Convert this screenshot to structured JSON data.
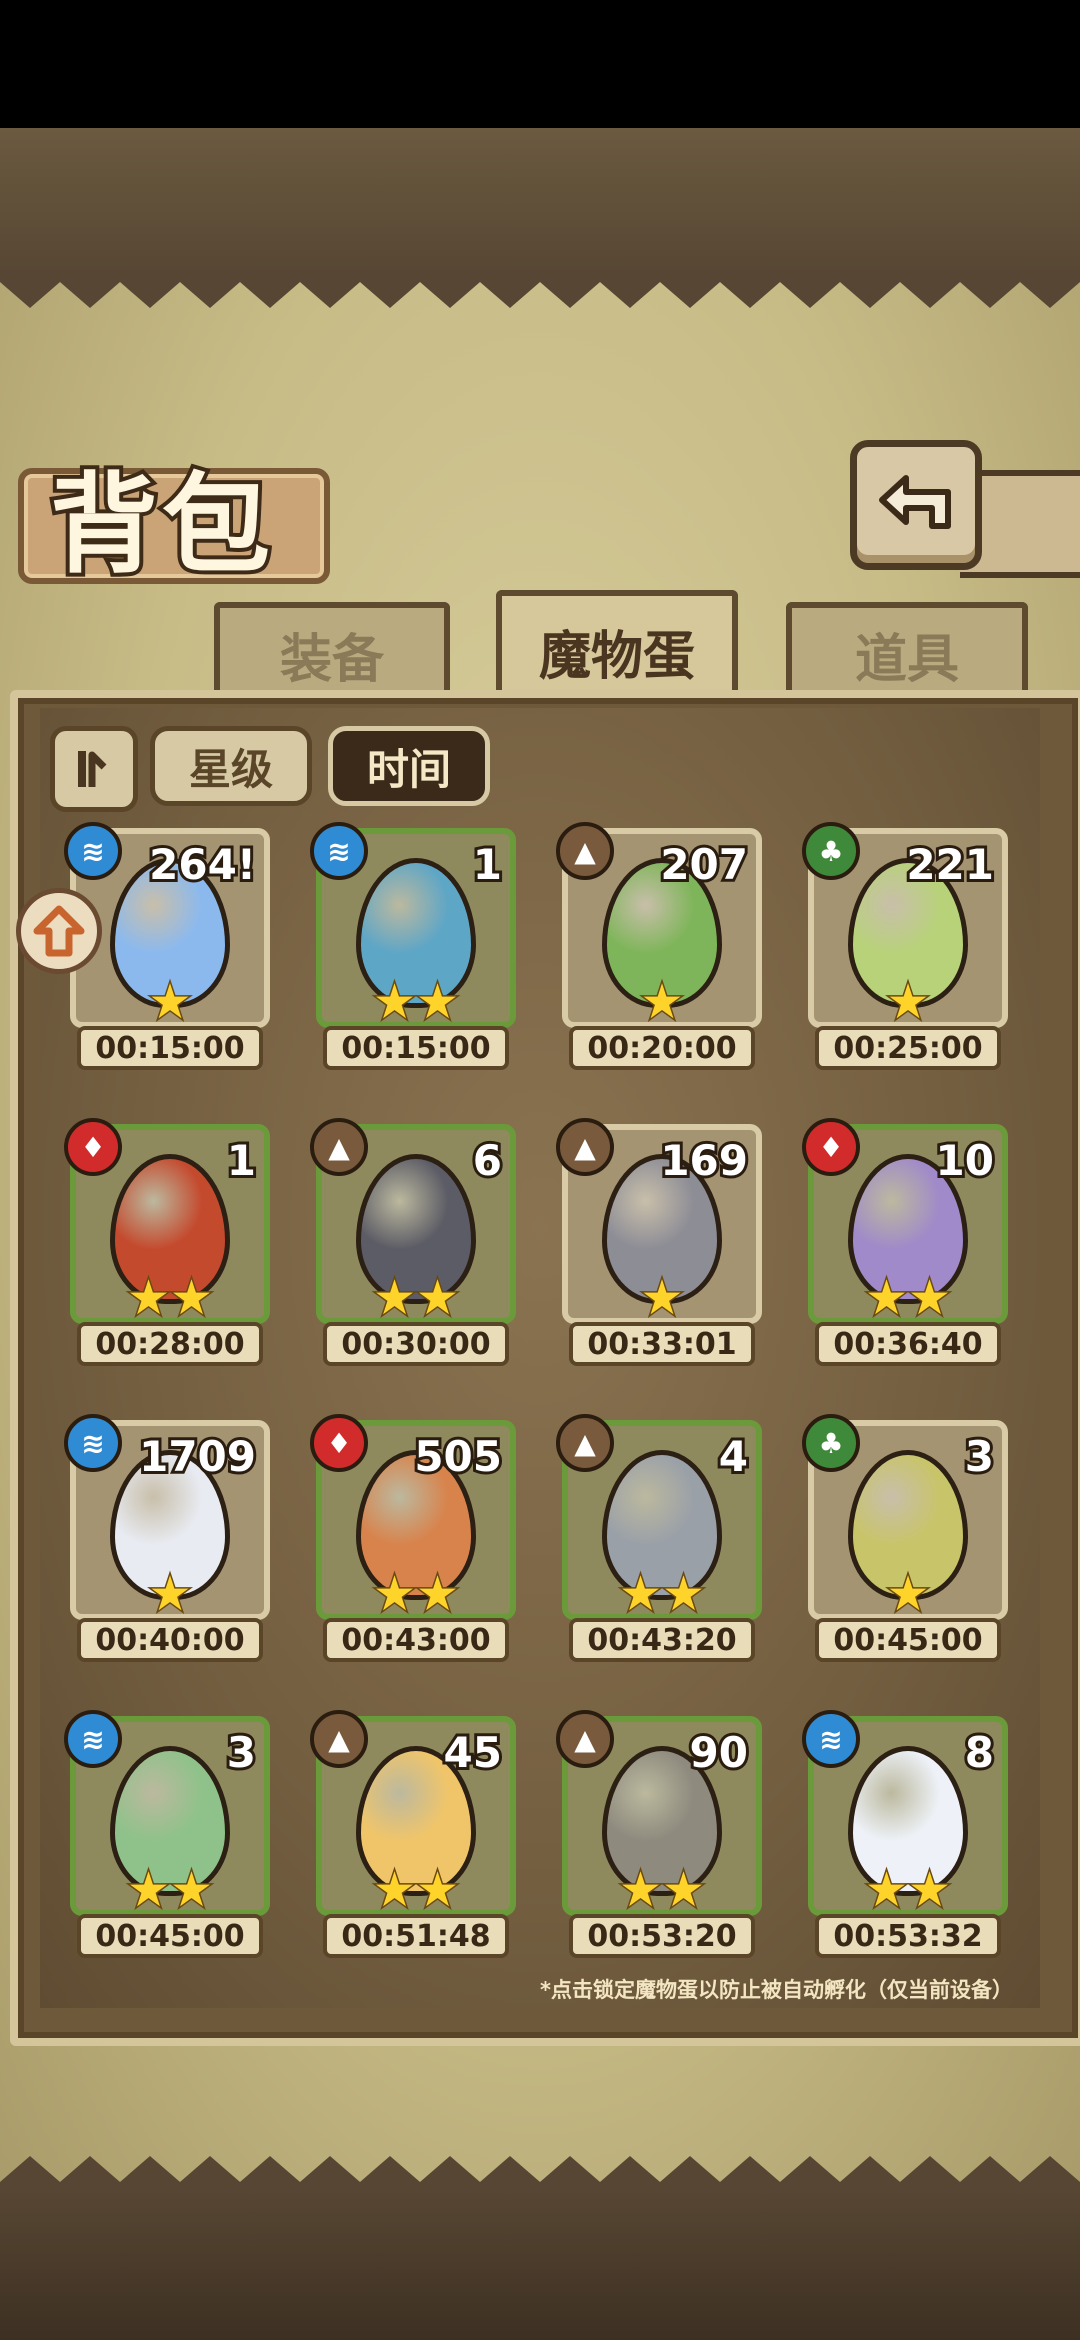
{
  "header": {
    "title": "背包",
    "back_icon": "back-arrow-icon"
  },
  "tabs": [
    {
      "label": "装备",
      "active": false
    },
    {
      "label": "魔物蛋",
      "active": true
    },
    {
      "label": "道具",
      "active": false
    }
  ],
  "sort": {
    "toggle_icon": "sort-order-icon",
    "star_label": "星级",
    "time_label": "时间",
    "active": "时间"
  },
  "eggs": [
    {
      "count": "264!",
      "element": "water",
      "stars": 1,
      "time": "00:15:00",
      "color": "#8bb9ee"
    },
    {
      "count": "1",
      "element": "water",
      "stars": 2,
      "time": "00:15:00",
      "color": "#5ea6c6"
    },
    {
      "count": "207",
      "element": "earth",
      "stars": 1,
      "time": "00:20:00",
      "color": "#7fb55a"
    },
    {
      "count": "221",
      "element": "grass",
      "stars": 1,
      "time": "00:25:00",
      "color": "#b8d27a"
    },
    {
      "count": "1",
      "element": "fire",
      "stars": 2,
      "time": "00:28:00",
      "color": "#c44a2e"
    },
    {
      "count": "6",
      "element": "earth",
      "stars": 2,
      "time": "00:30:00",
      "color": "#5c5c66"
    },
    {
      "count": "169",
      "element": "earth",
      "stars": 1,
      "time": "00:33:01",
      "color": "#8d8d96"
    },
    {
      "count": "10",
      "element": "fire",
      "stars": 2,
      "time": "00:36:40",
      "color": "#a08ac9"
    },
    {
      "count": "1709",
      "element": "water",
      "stars": 1,
      "time": "00:40:00",
      "color": "#e8ebf2"
    },
    {
      "count": "505",
      "element": "fire",
      "stars": 2,
      "time": "00:43:00",
      "color": "#d8834c"
    },
    {
      "count": "4",
      "element": "earth",
      "stars": 2,
      "time": "00:43:20",
      "color": "#9aa0a8"
    },
    {
      "count": "3",
      "element": "grass",
      "stars": 1,
      "time": "00:45:00",
      "color": "#c8c46a"
    },
    {
      "count": "3",
      "element": "water",
      "stars": 2,
      "time": "00:45:00",
      "color": "#8fc28a"
    },
    {
      "count": "45",
      "element": "earth",
      "stars": 2,
      "time": "00:51:48",
      "color": "#f0c56a"
    },
    {
      "count": "90",
      "element": "earth",
      "stars": 2,
      "time": "00:53:20",
      "color": "#8e8a7e"
    },
    {
      "count": "8",
      "element": "water",
      "stars": 2,
      "time": "00:53:32",
      "color": "#eef2f8"
    }
  ],
  "lock_icon": "lock-toggle-icon",
  "hint": "*点击锁定魔物蛋以防止被自动孵化（仅当前设备）",
  "colors": {
    "water": "#2f8bd4",
    "earth": "#7a5a3c",
    "grass": "#3f8a3a",
    "fire": "#d22b2b",
    "star": "#ffd42a"
  }
}
